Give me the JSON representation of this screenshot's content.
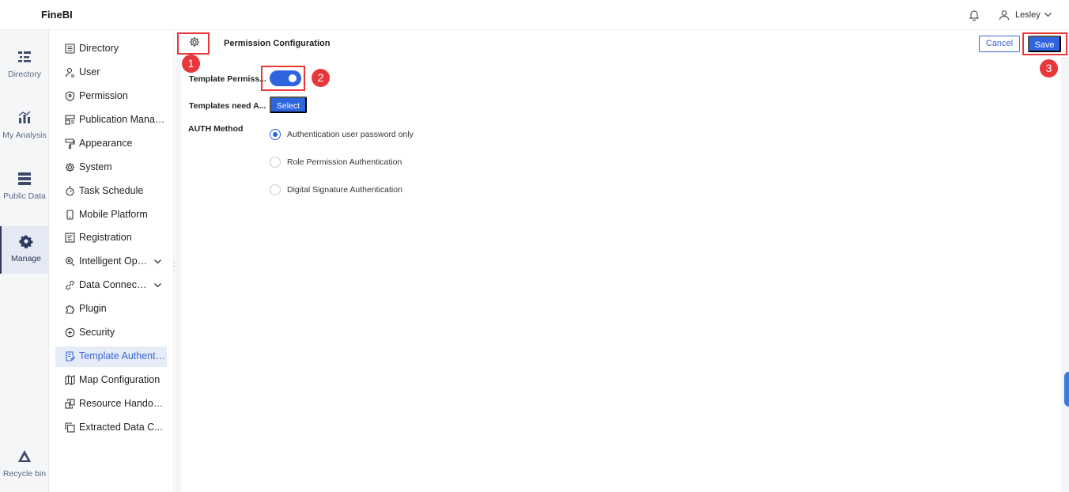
{
  "app": {
    "name": "FineBI"
  },
  "topbar": {
    "user_name": "Lesley"
  },
  "rail": {
    "items": [
      {
        "label": "Directory",
        "icon": "list-icon"
      },
      {
        "label": "My Analysis",
        "icon": "bar-chart-icon"
      },
      {
        "label": "Public Data",
        "icon": "database-icon"
      },
      {
        "label": "Manage",
        "icon": "gear-icon",
        "active": true
      },
      {
        "label": "Recycle bin",
        "icon": "triangle-bin-icon"
      }
    ]
  },
  "subnav": {
    "items": [
      {
        "label": "Directory",
        "icon": "list-icon"
      },
      {
        "label": "User",
        "icon": "user-icon"
      },
      {
        "label": "Permission",
        "icon": "shield-icon"
      },
      {
        "label": "Publication Management",
        "icon": "publication-icon"
      },
      {
        "label": "Appearance",
        "icon": "paint-roller-icon"
      },
      {
        "label": "System",
        "icon": "gear-icon"
      },
      {
        "label": "Task Schedule",
        "icon": "stopwatch-icon"
      },
      {
        "label": "Mobile Platform",
        "icon": "mobile-icon"
      },
      {
        "label": "Registration",
        "icon": "registration-icon"
      },
      {
        "label": "Intelligent Operation",
        "icon": "search-gear-icon",
        "expandable": true
      },
      {
        "label": "Data Connection",
        "icon": "link-icon",
        "expandable": true
      },
      {
        "label": "Plugin",
        "icon": "puzzle-icon"
      },
      {
        "label": "Security",
        "icon": "shield-plus-icon"
      },
      {
        "label": "Template Authentication",
        "icon": "edit-document-icon",
        "active": true
      },
      {
        "label": "Map Configuration",
        "icon": "map-icon"
      },
      {
        "label": "Resource Handover",
        "icon": "handover-icon"
      },
      {
        "label": "Extracted Data C...",
        "icon": "copy-icon"
      }
    ]
  },
  "header": {
    "title": "Permission Configuration",
    "cancel_label": "Cancel",
    "save_label": "Save"
  },
  "form": {
    "template_permission_label": "Template Permiss...",
    "template_permission_enabled": true,
    "templates_need_auth_label": "Templates need A...",
    "select_label": "Select",
    "auth_method_label": "AUTH Method",
    "auth_options": [
      {
        "label": "Authentication user password only",
        "checked": true
      },
      {
        "label": "Role Permission Authentication",
        "checked": false
      },
      {
        "label": "Digital Signature Authentication",
        "checked": false
      }
    ]
  },
  "annotations": {
    "badge_1": "1",
    "badge_2": "2",
    "badge_3": "3"
  },
  "colors": {
    "accent": "#2f64e0",
    "annotation": "#e8373a",
    "nav_active_bg": "#e6ebf8"
  }
}
